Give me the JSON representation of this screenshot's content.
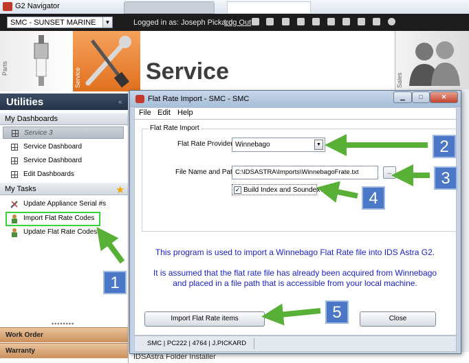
{
  "app": {
    "title": "G2 Navigator",
    "dealer": "SMC - SUNSET MARINE",
    "logged_in_label": "Logged in as: Joseph Pickard",
    "logout": "Log Out"
  },
  "banner": {
    "parts_label": "Parts",
    "service_label": "Service",
    "service_title": "Service",
    "sales_label": "Sales"
  },
  "sidebar": {
    "title": "Utilities",
    "collapse_icon": "double-chevron-left-icon",
    "my_dashboards": "My Dashboards",
    "dashboards": [
      "Service 3",
      "Service Dashboard",
      "Service Dashboard",
      "Edit Dashboards"
    ],
    "my_tasks": "My Tasks",
    "tasks": [
      "Update Appliance Serial #s",
      "Import Flat Rate Codes",
      "Update Flat Rate Codes"
    ],
    "bottom": [
      "Work Order",
      "Warranty"
    ]
  },
  "dialog": {
    "title": "Flat Rate Import - SMC - SMC",
    "menu": [
      "File",
      "Edit",
      "Help"
    ],
    "group_title": "Flat Rate Import",
    "provider_label": "Flat Rate Provider",
    "provider_value": "Winnebago",
    "path_label": "File Name and Path",
    "path_value": "C:\\IDSASTRA\\Imports\\WinnebagoFrate.txt",
    "browse_label": "...",
    "checkbox_label": "Build Index and Soundex?",
    "checkbox_checked": true,
    "info_line1": "This program is used to import a Winnebago Flat Rate file into IDS Astra G2.",
    "info_line2": "It is assumed that the flat rate file has already been acquired from Winnebago",
    "info_line3": "and placed in a file path that is accessible from your local machine.",
    "import_button": "Import Flat Rate items",
    "close_button": "Close",
    "status": "SMC | PC222 | 4764 | J.PICKARD"
  },
  "background": {
    "bottom_text": "IDSAstra Folder Installer"
  },
  "annotations": [
    "1",
    "2",
    "3",
    "4",
    "5"
  ],
  "colors": {
    "annotation_badge": "#4a78c6",
    "annotation_arrow": "#58b036",
    "highlight_border": "#39d339",
    "service_orange": "#e0701e",
    "info_text": "#1a22c8"
  }
}
